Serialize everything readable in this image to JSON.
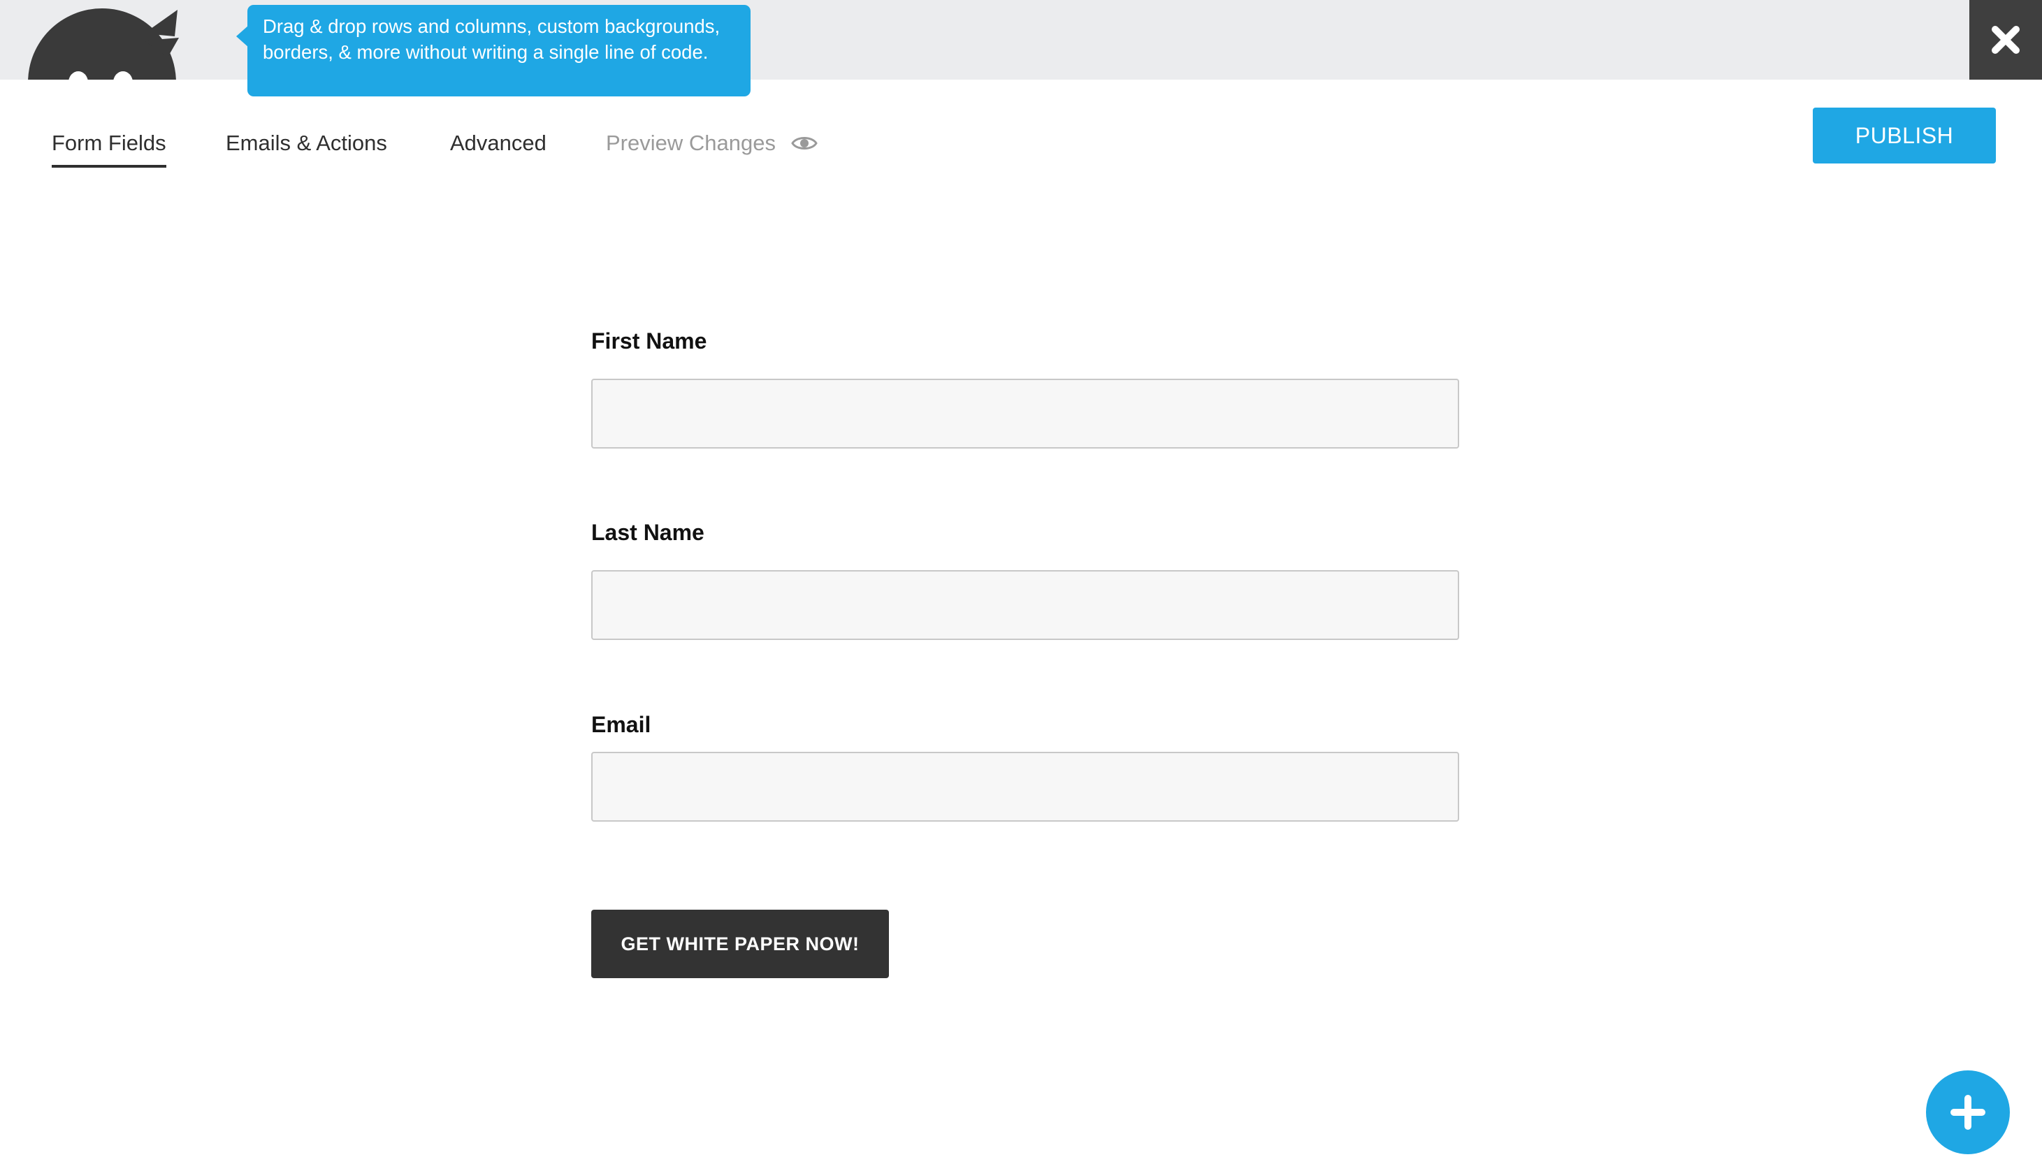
{
  "header": {
    "logo_icon": "ninja-logo-icon",
    "tooltip": "Drag & drop rows and columns, custom backgrounds, borders, & more without writing a single line of code.",
    "close_icon": "close-x-icon"
  },
  "tabs": [
    {
      "label": "Form Fields",
      "active": true
    },
    {
      "label": "Emails & Actions"
    },
    {
      "label": "Advanced"
    },
    {
      "label": "Preview Changes",
      "icon": "eye-icon",
      "muted": true
    }
  ],
  "publish_label": "PUBLISH",
  "form": {
    "fields": [
      {
        "label": "First Name",
        "value": ""
      },
      {
        "label": "Last Name",
        "value": ""
      },
      {
        "label": "Email",
        "value": ""
      }
    ],
    "submit_label": "GET WHITE PAPER NOW!"
  },
  "fab_icon": "plus-icon",
  "colors": {
    "accent": "#1fa7e4",
    "dark": "#333333",
    "topbar": "#ebecee",
    "close_bg": "#3f3f3f"
  }
}
